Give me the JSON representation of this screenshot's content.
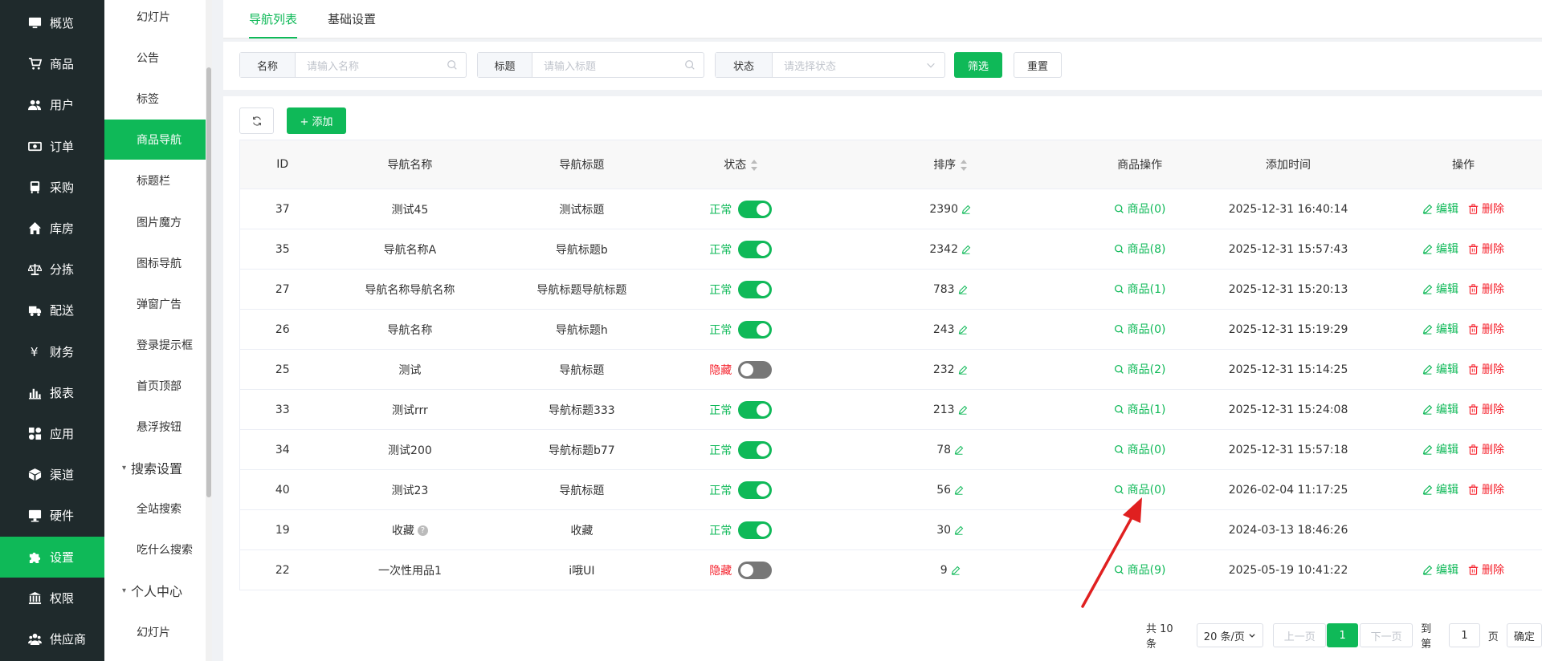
{
  "sidebar": {
    "items": [
      {
        "label": "概览",
        "icon": "monitor-icon"
      },
      {
        "label": "商品",
        "icon": "cart-icon"
      },
      {
        "label": "用户",
        "icon": "users-icon"
      },
      {
        "label": "订单",
        "icon": "money-icon"
      },
      {
        "label": "采购",
        "icon": "bus-icon"
      },
      {
        "label": "库房",
        "icon": "home-icon"
      },
      {
        "label": "分拣",
        "icon": "scale-icon"
      },
      {
        "label": "配送",
        "icon": "truck-icon"
      },
      {
        "label": "财务",
        "icon": "yen-icon"
      },
      {
        "label": "报表",
        "icon": "bar-chart-icon"
      },
      {
        "label": "应用",
        "icon": "apps-icon"
      },
      {
        "label": "渠道",
        "icon": "cube-icon"
      },
      {
        "label": "硬件",
        "icon": "desktop-icon"
      },
      {
        "label": "设置",
        "icon": "puzzle-icon",
        "active": true
      },
      {
        "label": "权限",
        "icon": "bank-icon"
      },
      {
        "label": "供应商",
        "icon": "group-icon"
      }
    ]
  },
  "subnav": {
    "items": [
      {
        "label": "幻灯片"
      },
      {
        "label": "公告"
      },
      {
        "label": "标签"
      },
      {
        "label": "商品导航",
        "active": true
      },
      {
        "label": "标题栏"
      },
      {
        "label": "图片魔方"
      },
      {
        "label": "图标导航"
      },
      {
        "label": "弹窗广告"
      },
      {
        "label": "登录提示框"
      },
      {
        "label": "首页顶部"
      },
      {
        "label": "悬浮按钮"
      },
      {
        "label": "搜索设置",
        "group": true
      },
      {
        "label": "全站搜索"
      },
      {
        "label": "吃什么搜索"
      },
      {
        "label": "个人中心",
        "group": true
      },
      {
        "label": "幻灯片"
      }
    ]
  },
  "tabs": [
    {
      "label": "导航列表",
      "active": true
    },
    {
      "label": "基础设置"
    }
  ],
  "filter": {
    "name_label": "名称",
    "name_placeholder": "请输入名称",
    "title_label": "标题",
    "title_placeholder": "请输入标题",
    "status_label": "状态",
    "status_placeholder": "请选择状态",
    "filter_button": "筛选",
    "reset_button": "重置"
  },
  "toolbar": {
    "add_button": "+ 添加"
  },
  "table": {
    "headers": [
      "ID",
      "导航名称",
      "导航标题",
      "状态",
      "排序",
      "商品操作",
      "添加时间",
      "操作"
    ],
    "rows": [
      {
        "id": "37",
        "name": "测试45",
        "title": "测试标题",
        "status": "正常",
        "on": true,
        "sort": "2390",
        "goods": "商品(0)",
        "time": "2025-12-31 16:40:14",
        "ops": true
      },
      {
        "id": "35",
        "name": "导航名称A",
        "title": "导航标题b",
        "status": "正常",
        "on": true,
        "sort": "2342",
        "goods": "商品(8)",
        "time": "2025-12-31 15:57:43",
        "ops": true
      },
      {
        "id": "27",
        "name": "导航名称导航名称",
        "title": "导航标题导航标题",
        "status": "正常",
        "on": true,
        "sort": "783",
        "goods": "商品(1)",
        "time": "2025-12-31 15:20:13",
        "ops": true
      },
      {
        "id": "26",
        "name": "导航名称",
        "title": "导航标题h",
        "status": "正常",
        "on": true,
        "sort": "243",
        "goods": "商品(0)",
        "time": "2025-12-31 15:19:29",
        "ops": true
      },
      {
        "id": "25",
        "name": "测试",
        "title": "导航标题",
        "status": "隐藏",
        "on": false,
        "sort": "232",
        "goods": "商品(2)",
        "time": "2025-12-31 15:14:25",
        "ops": true
      },
      {
        "id": "33",
        "name": "测试rrr",
        "title": "导航标题333",
        "status": "正常",
        "on": true,
        "sort": "213",
        "goods": "商品(1)",
        "time": "2025-12-31 15:24:08",
        "ops": true
      },
      {
        "id": "34",
        "name": "测试200",
        "title": "导航标题b77",
        "status": "正常",
        "on": true,
        "sort": "78",
        "goods": "商品(0)",
        "time": "2025-12-31 15:57:18",
        "ops": true
      },
      {
        "id": "40",
        "name": "测试23",
        "title": "导航标题",
        "status": "正常",
        "on": true,
        "sort": "56",
        "goods": "商品(0)",
        "time": "2026-02-04 11:17:25",
        "ops": true
      },
      {
        "id": "19",
        "name": "收藏",
        "title": "收藏",
        "status": "正常",
        "on": true,
        "sort": "30",
        "goods": "",
        "time": "2024-03-13 18:46:26",
        "ops": false,
        "help": true
      },
      {
        "id": "22",
        "name": "一次性用品1",
        "title": "i哦UI",
        "status": "隐藏",
        "on": false,
        "sort": "9",
        "goods": "商品(9)",
        "time": "2025-05-19 10:41:22",
        "ops": true
      }
    ],
    "edit_label": "编辑",
    "delete_label": "删除"
  },
  "pagination": {
    "total": "共 10 条",
    "page_size": "20 条/页",
    "prev": "上一页",
    "current": "1",
    "next": "下一页",
    "goto_label": "到第",
    "goto_value": "1",
    "page_unit": "页",
    "confirm": "确定"
  },
  "colors": {
    "accent": "#0fb958",
    "danger": "#f5222d",
    "sidebar_bg": "#1f2a2c",
    "annotation_arrow": "#e02020"
  }
}
